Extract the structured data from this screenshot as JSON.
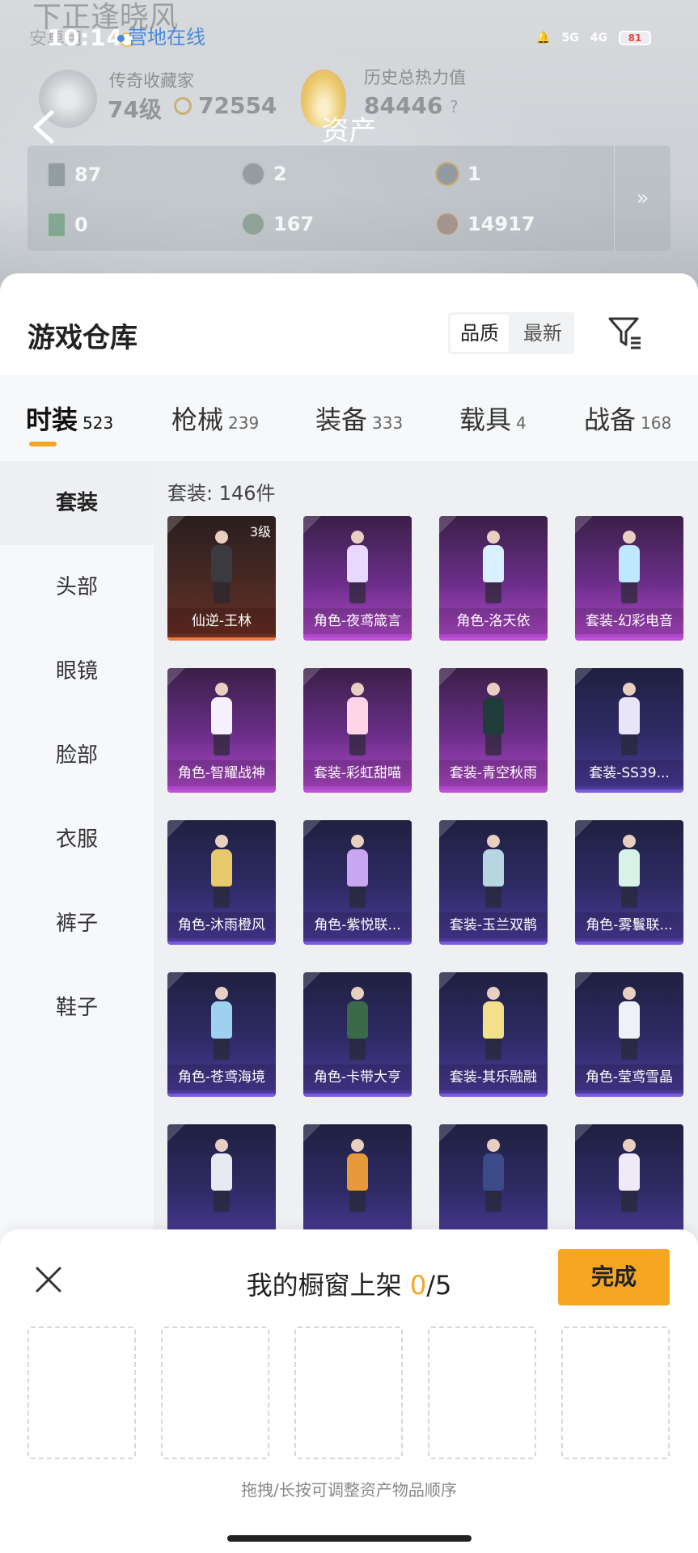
{
  "status_bar": {
    "time": "10:14",
    "network": [
      "5G",
      "4G"
    ],
    "battery": "81"
  },
  "profile": {
    "name": "下正逢晓风",
    "sub": "安卓用",
    "online_status": "营地在线",
    "collector_label": "传奇收藏家",
    "collector_level": "74级",
    "collector_points": "72554",
    "heat_label": "历史总热力值",
    "heat_value": "84446",
    "help": "?"
  },
  "header": {
    "title": "资产",
    "back_icon": "chevron-left-icon"
  },
  "stats": [
    {
      "icon": "card-icon",
      "value": "87"
    },
    {
      "icon": "silver-coin-icon",
      "value": "2"
    },
    {
      "icon": "gold-coin-icon",
      "value": "1"
    },
    {
      "icon": "green-card-icon",
      "value": "0"
    },
    {
      "icon": "gem-icon",
      "value": "167"
    },
    {
      "icon": "bronze-coin-icon",
      "value": "14917"
    }
  ],
  "stats_more": "»",
  "warehouse": {
    "title": "游戏仓库",
    "sort_options": [
      "品质",
      "最新"
    ],
    "filter_icon": "filter-icon"
  },
  "tabs": [
    {
      "label": "时装",
      "count": "523"
    },
    {
      "label": "枪械",
      "count": "239"
    },
    {
      "label": "装备",
      "count": "333"
    },
    {
      "label": "载具",
      "count": "4"
    },
    {
      "label": "战备",
      "count": "168"
    }
  ],
  "sidebar": [
    "套装",
    "头部",
    "眼镜",
    "脸部",
    "衣服",
    "裤子",
    "鞋子"
  ],
  "grid": {
    "count_text": "套装: 146件",
    "items": [
      {
        "name": "仙逆-王林",
        "level": "3级",
        "rarity": "gold"
      },
      {
        "name": "角色-夜鸢箴言",
        "level": "",
        "rarity": "purple"
      },
      {
        "name": "角色-洛天依",
        "level": "",
        "rarity": "purple"
      },
      {
        "name": "套装-幻彩电音",
        "level": "",
        "rarity": "purple"
      },
      {
        "name": "角色-智耀战神",
        "level": "",
        "rarity": "purple"
      },
      {
        "name": "套装-彩虹甜喵",
        "level": "",
        "rarity": "purple"
      },
      {
        "name": "套装-青空秋雨",
        "level": "",
        "rarity": "purple"
      },
      {
        "name": "套装-SS39...",
        "level": "",
        "rarity": "blue"
      },
      {
        "name": "角色-沐雨橙风",
        "level": "",
        "rarity": "blue"
      },
      {
        "name": "角色-紫悦联...",
        "level": "",
        "rarity": "blue"
      },
      {
        "name": "套装-玉兰双鹊",
        "level": "",
        "rarity": "blue"
      },
      {
        "name": "角色-雾鬟联...",
        "level": "",
        "rarity": "blue"
      },
      {
        "name": "角色-苍鸢海境",
        "level": "",
        "rarity": "blue"
      },
      {
        "name": "角色-卡带大亨",
        "level": "",
        "rarity": "blue"
      },
      {
        "name": "套装-其乐融融",
        "level": "",
        "rarity": "blue"
      },
      {
        "name": "角色-莹鸢雪晶",
        "level": "",
        "rarity": "blue"
      },
      {
        "name": "",
        "level": "",
        "rarity": "blue"
      },
      {
        "name": "",
        "level": "",
        "rarity": "blue"
      },
      {
        "name": "",
        "level": "",
        "rarity": "blue"
      },
      {
        "name": "",
        "level": "",
        "rarity": "blue"
      }
    ]
  },
  "share_icon": "share-out-icon",
  "shelf": {
    "title": "我的橱窗上架",
    "count": "0",
    "total": "/5",
    "done_label": "完成",
    "hint": "拖拽/长按可调整资产物品顺序",
    "slots": 5
  }
}
